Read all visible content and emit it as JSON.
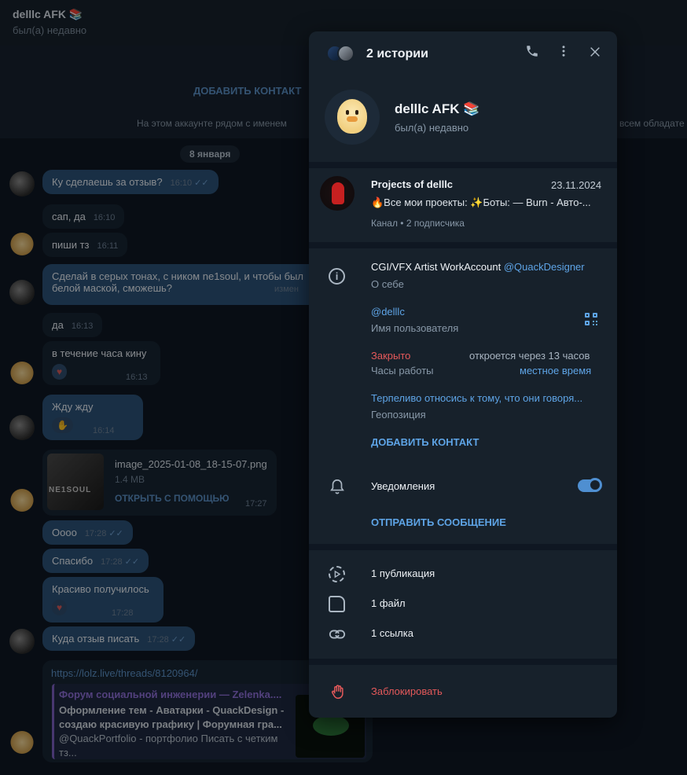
{
  "chat": {
    "title": "delllc AFK 📚",
    "status": "был(а) недавно",
    "add_contact": "ДОБАВИТЬ КОНТАКТ",
    "notice": "На этом аккаунте рядом с именем",
    "notice_tail": "всем обладате",
    "date": "8 января",
    "messages": [
      {
        "text": "Ку сделаешь за отзыв?",
        "time": "16:10"
      },
      {
        "text": "сап, да",
        "time": "16:10"
      },
      {
        "text": "пиши тз",
        "time": "16:11"
      },
      {
        "text": "Сделай в серых тонах, с ником ne1soul, и чтобы был",
        "text2": "белой маской, сможешь?",
        "time": "измен"
      },
      {
        "text": "да",
        "time": "16:13"
      },
      {
        "text": "в течение часа кину",
        "time": "16:13"
      },
      {
        "text": "Жду жду",
        "time": "16:14"
      },
      {
        "text": "Оооо",
        "time": "17:28"
      },
      {
        "text": "Спасибо",
        "time": "17:28"
      },
      {
        "text": "Красиво получилось",
        "time": "17:28"
      },
      {
        "text": "Куда отзыв писать",
        "time": "17:28"
      }
    ],
    "file": {
      "name": "image_2025-01-08_18-15-07.png",
      "size": "1.4 MB",
      "open": "ОТКРЫТЬ С ПОМОЩЬЮ",
      "time": "17:27",
      "thumb_text": "NE1SOUL"
    },
    "link": {
      "url": "https://lolz.live/threads/8120964/",
      "site": "Форум социальной инженерии — Zelenka....",
      "title": "Оформление тем - Аватарки - QuackDesign - создаю красивую графику | Форумная гра...",
      "desc": "@QuackPortfolio - портфолио Писать с четким тз..."
    }
  },
  "panel": {
    "stories_label": "2 истории",
    "name": "delllc AFK 📚",
    "status": "был(а) недавно",
    "channel": {
      "name": "Projects of delllc",
      "date": "23.11.2024",
      "text": "🔥Все мои проекты: ✨Боты: — Burn - Авто-...",
      "sub": "Канал • 2 подписчика"
    },
    "bio": {
      "text": "CGI/VFX Artist WorkAccount ",
      "mention": "@QuackDesigner",
      "label": "О себе"
    },
    "username": {
      "value": "@delllc",
      "label": "Имя пользователя"
    },
    "hours": {
      "state": "Закрыто",
      "opens": "откроется через 13 часов",
      "label": "Часы работы",
      "local": "местное время"
    },
    "geo": {
      "value": "Терпеливо относись к тому, что они говоря...",
      "label": "Геопозиция"
    },
    "add_contact": "ДОБАВИТЬ КОНТАКТ",
    "notifications": {
      "label": "Уведомления",
      "enabled": true
    },
    "send_message": "ОТПРАВИТЬ СООБЩЕНИЕ",
    "media": [
      {
        "icon": "stories-icon",
        "label": "1 публикация"
      },
      {
        "icon": "file-icon",
        "label": "1 файл"
      },
      {
        "icon": "link-icon",
        "label": "1 ссылка"
      }
    ],
    "block": "Заблокировать"
  },
  "colors": {
    "accent": "#5ea4e6",
    "danger": "#e4595a",
    "panel_bg": "#17212b"
  }
}
